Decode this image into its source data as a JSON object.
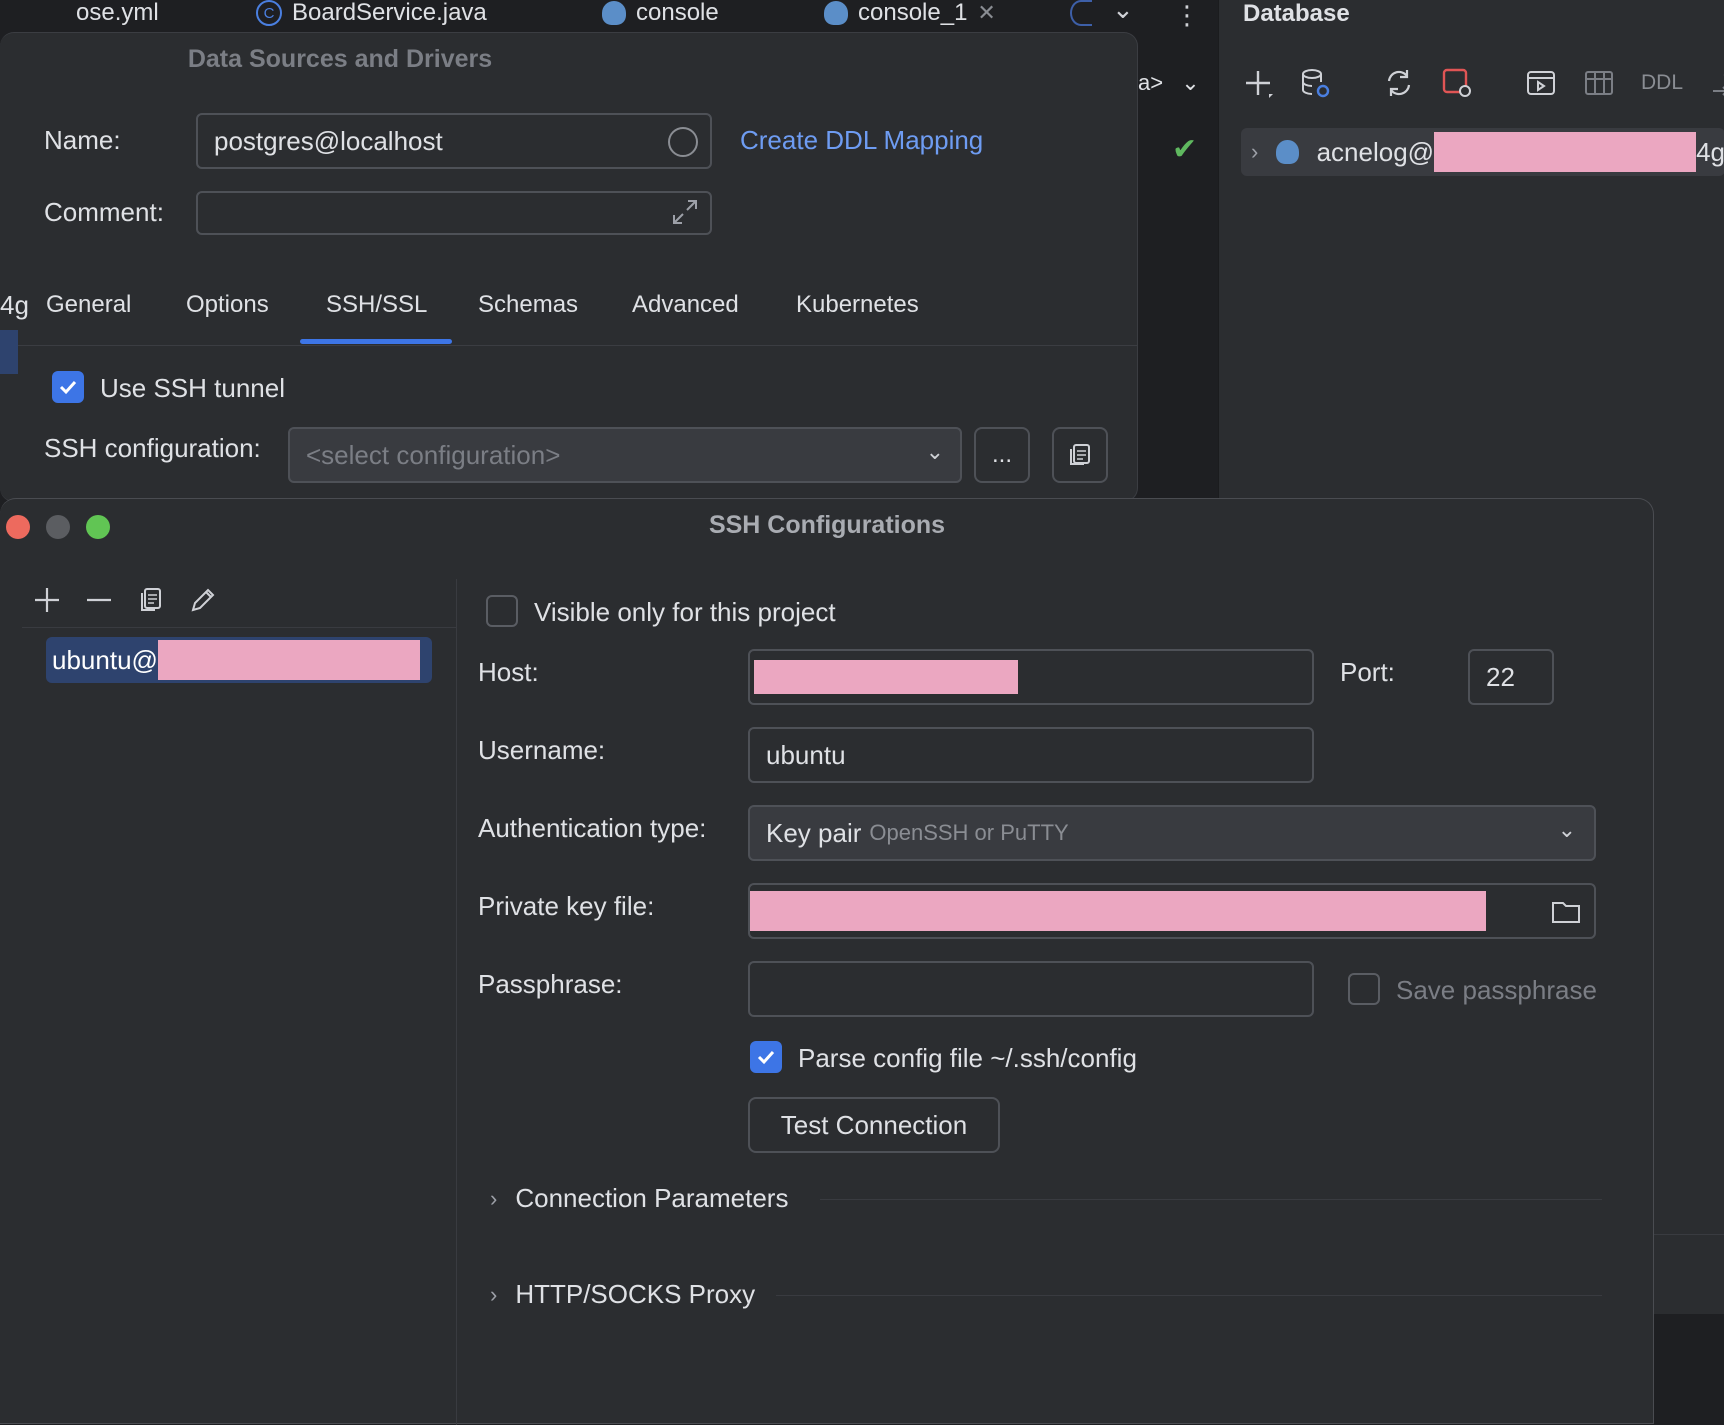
{
  "ide": {
    "tabs": [
      {
        "label": "ose.yml"
      },
      {
        "label": "BoardService.java",
        "icon": "java-class-icon"
      },
      {
        "label": "console",
        "icon": "postgres-icon"
      },
      {
        "label": "console_1",
        "icon": "postgres-icon"
      }
    ],
    "editor_combo": "a>"
  },
  "database_panel": {
    "title": "Database",
    "ddl_label": "DDL",
    "tree": [
      {
        "label": "acnelog@",
        "suffix": "4g"
      }
    ]
  },
  "data_sources_dialog": {
    "title": "Data Sources and Drivers",
    "name_label": "Name:",
    "name_value": "postgres@localhost",
    "create_ddl_link": "Create DDL Mapping",
    "comment_label": "Comment:",
    "comment_value": "",
    "left_edge_text": "4g",
    "tabs": [
      {
        "label": "General"
      },
      {
        "label": "Options"
      },
      {
        "label": "SSH/SSL",
        "active": true
      },
      {
        "label": "Schemas"
      },
      {
        "label": "Advanced"
      },
      {
        "label": "Kubernetes"
      }
    ],
    "use_ssh_label": "Use SSH tunnel",
    "use_ssh_checked": true,
    "ssh_config_label": "SSH configuration:",
    "ssh_config_placeholder": "<select configuration>",
    "ellipsis_label": "..."
  },
  "ssh_dialog": {
    "title": "SSH Configurations",
    "list_items": [
      {
        "label": "ubuntu@"
      }
    ],
    "visible_only_label": "Visible only for this project",
    "visible_only_checked": false,
    "host_label": "Host:",
    "port_label": "Port:",
    "port_value": "22",
    "username_label": "Username:",
    "username_value": "ubuntu",
    "auth_type_label": "Authentication type:",
    "auth_type_value": "Key pair",
    "auth_type_hint": "OpenSSH or PuTTY",
    "private_key_label": "Private key file:",
    "passphrase_label": "Passphrase:",
    "passphrase_value": "",
    "save_passphrase_label": "Save passphrase",
    "parse_config_label": "Parse config file ~/.ssh/config",
    "parse_config_checked": true,
    "test_connection_label": "Test Connection",
    "sections": [
      {
        "label": "Connection Parameters"
      },
      {
        "label": "HTTP/SOCKS Proxy"
      }
    ]
  },
  "colors": {
    "accent": "#3d75e6",
    "link": "#6e9cf2",
    "redaction": "#eba7c1",
    "traffic_red": "#ed6a5e",
    "traffic_gray": "#5b5d61",
    "traffic_green": "#61c554",
    "ok_check": "#5fb85f"
  }
}
